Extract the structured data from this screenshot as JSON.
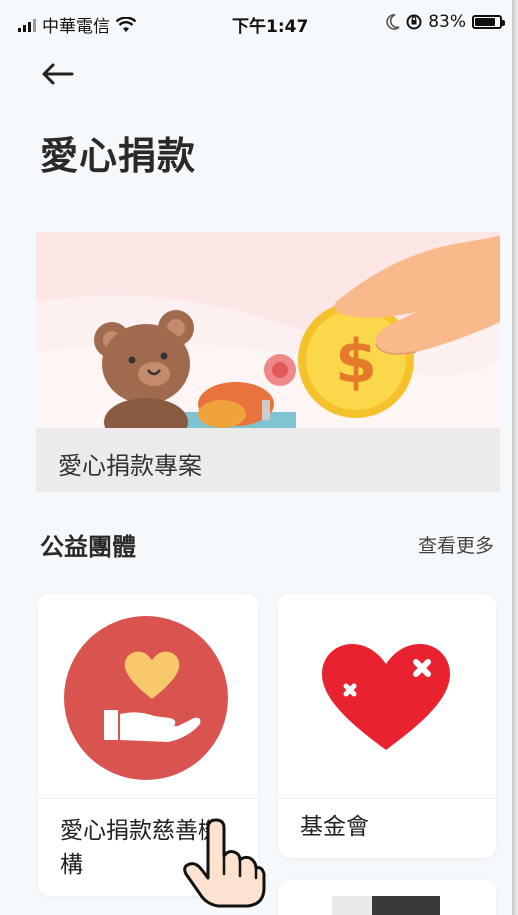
{
  "status_bar": {
    "carrier": "中華電信",
    "time": "下午1:47",
    "battery": "83%",
    "battery_level": 0.83
  },
  "header": {
    "back_icon": "arrow-left-icon",
    "title": "愛心捐款"
  },
  "banner": {
    "label": "愛心捐款專案"
  },
  "section": {
    "title": "公益團體",
    "see_more": "查看更多"
  },
  "cards": [
    {
      "label": "愛心捐款慈善機構",
      "icon": "heart-in-hand-icon",
      "color": "#d9534f"
    },
    {
      "label": "基金會",
      "icon": "broken-heart-icon",
      "color": "#e8232f"
    }
  ]
}
